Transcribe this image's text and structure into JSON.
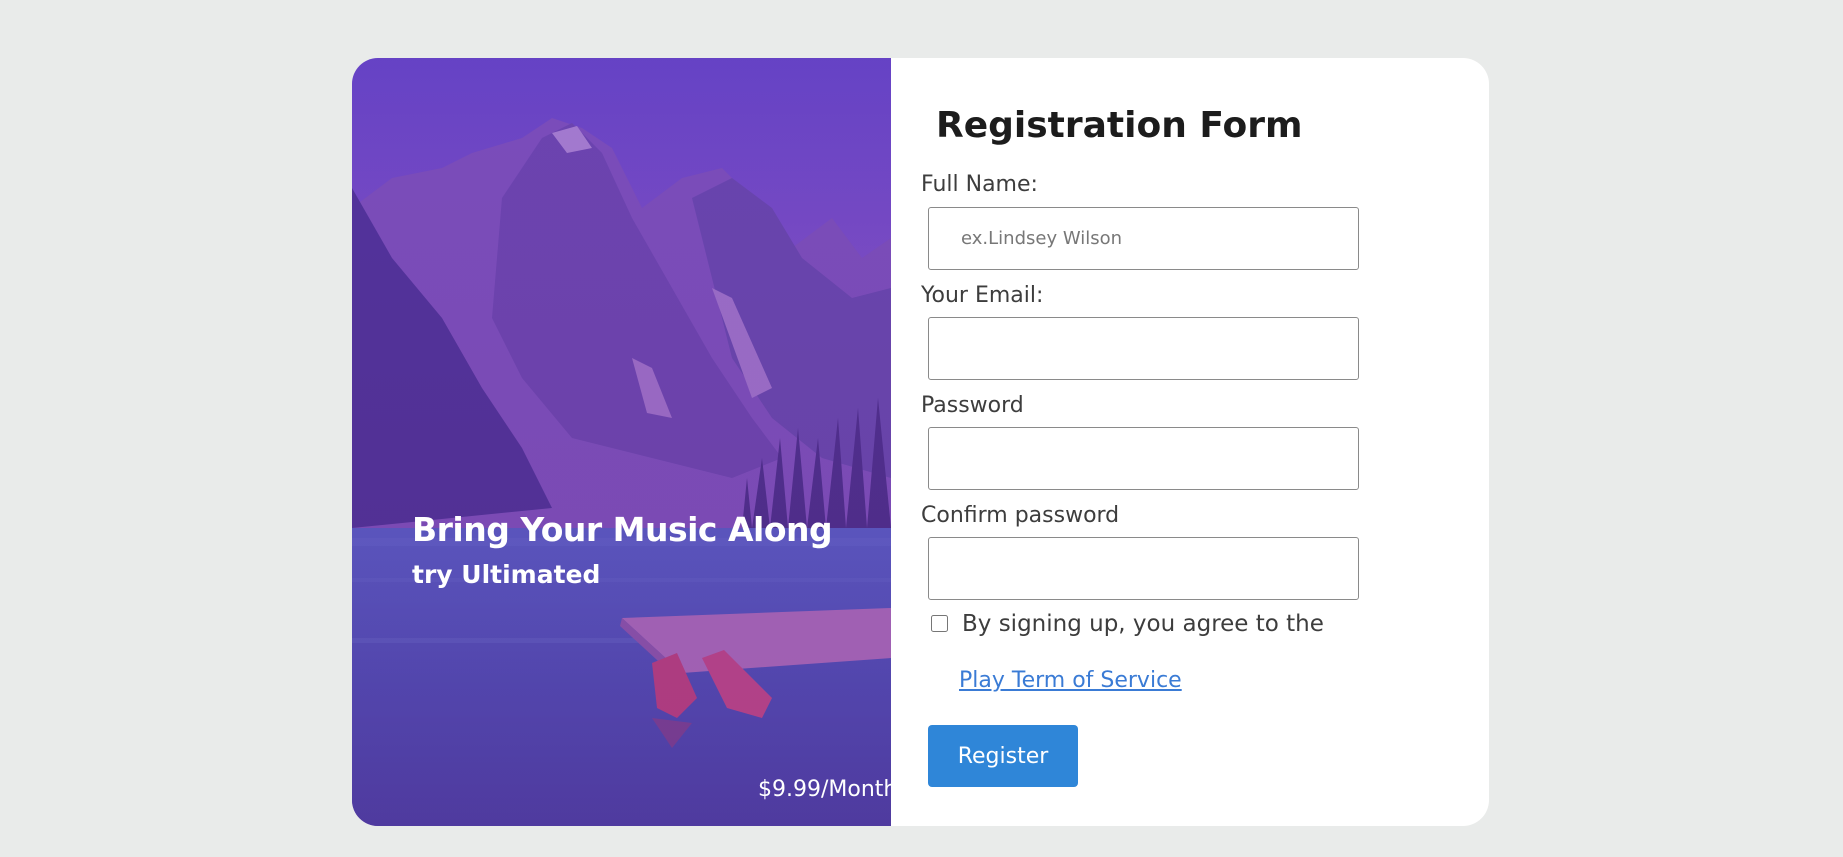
{
  "hero": {
    "title": "Bring Your Music Along",
    "subtitle": "try Ultimated",
    "price": "$9.99/Month"
  },
  "form": {
    "title": "Registration Form",
    "full_name": {
      "label": "Full Name:",
      "placeholder": "ex.Lindsey Wilson",
      "value": ""
    },
    "email": {
      "label": "Your Email:",
      "placeholder": "",
      "value": ""
    },
    "password": {
      "label": "Password",
      "placeholder": "",
      "value": ""
    },
    "confirm_password": {
      "label": "Confirm password",
      "placeholder": "",
      "value": ""
    },
    "agree_text": "By signing up, you agree to the",
    "tos_link": "Play Term of Service",
    "agree_checked": false,
    "submit_label": "Register"
  },
  "colors": {
    "page_background": "#e9ebea",
    "card_background": "#ffffff",
    "hero_overlay": "#6a3fb8",
    "link": "#3a7bd5",
    "button": "#2f86d8",
    "label_text": "#3d3d3d"
  },
  "icons": {
    "checkbox": "checkbox-icon"
  }
}
